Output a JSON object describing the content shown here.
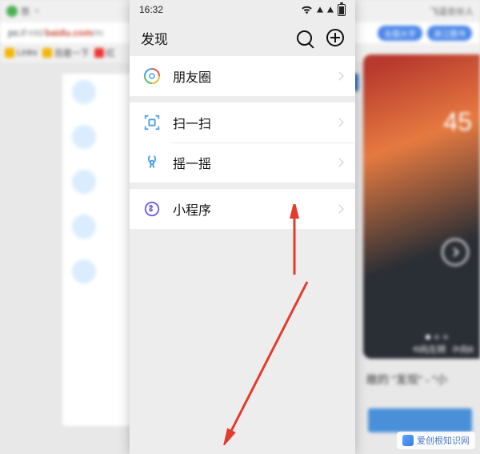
{
  "background": {
    "tab_title": "悠",
    "url_prefix": "ps://",
    "url_host": "baidu.com",
    "url_sub": "mld",
    "bookmarks": {
      "links_label": "Links",
      "baidu_label": "百度一下",
      "hs_label": "红"
    },
    "right_tool": "飞逗合伙人",
    "pills": [
      "全国大字",
      "浙江图书"
    ],
    "right_phone_clock": "45",
    "rotate_left": "⟲向左转",
    "rotate_right": "⟳向6",
    "desc_fragment": "敞的 \"发现\" - \"小",
    "close_x": "×"
  },
  "phone": {
    "status": {
      "time": "16:32"
    },
    "header": {
      "title": "发现"
    },
    "rows": {
      "moments": "朋友圈",
      "scan": "扫一扫",
      "shake": "摇一摇",
      "miniprogram": "小程序"
    },
    "icon_colors": {
      "moments_primary": "#4aa0e6",
      "scan_primary": "#4aa0e6",
      "shake_primary": "#4aa0e6",
      "miniprogram_primary": "#6a5de0"
    }
  },
  "watermark": "爱创根知识网",
  "arrow_color": "#e43b2f"
}
